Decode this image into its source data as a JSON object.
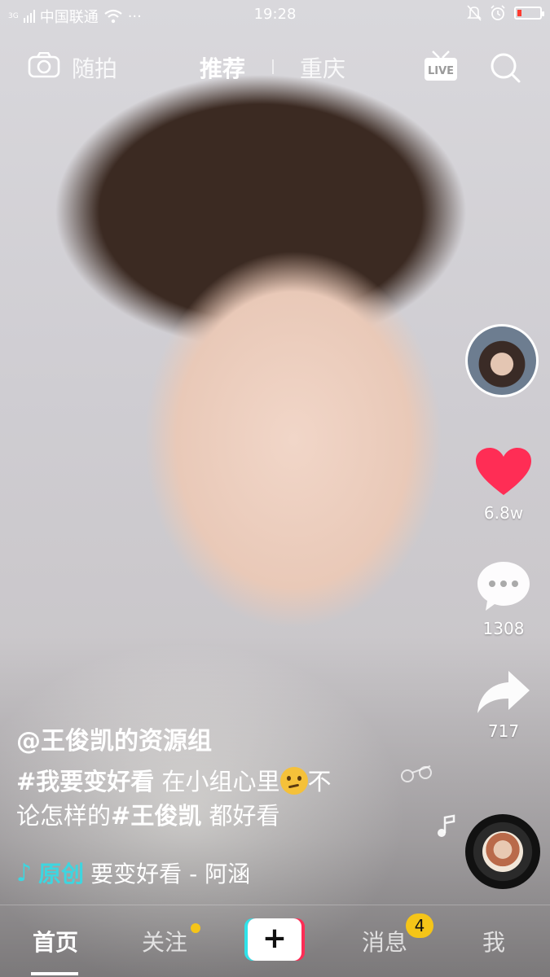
{
  "status": {
    "network": "3G",
    "carrier": "中国联通",
    "time": "19:28",
    "more": "···"
  },
  "nav": {
    "random": "随拍",
    "recommend": "推荐",
    "city": "重庆",
    "live": "LIVE"
  },
  "rail": {
    "likes": "6.8w",
    "comments": "1308",
    "shares": "717"
  },
  "caption": {
    "author": "@王俊凯的资源组",
    "hashtag1": "#我要变好看",
    "text1": " 在小组心里",
    "text2": "不",
    "text3": "论怎样的",
    "hashtag2": "#王俊凯",
    "text4": " 都好看"
  },
  "music": {
    "original": "原创",
    "title": "要变好看 - 阿涵"
  },
  "tabs": {
    "home": "首页",
    "follow": "关注",
    "plus": "+",
    "messages": "消息",
    "messages_badge": "4",
    "me": "我"
  },
  "colors": {
    "accent_cyan": "#2fe3ea",
    "accent_red": "#fe2c55",
    "like_red": "#ff2d55",
    "badge_yellow": "#f5c518"
  }
}
